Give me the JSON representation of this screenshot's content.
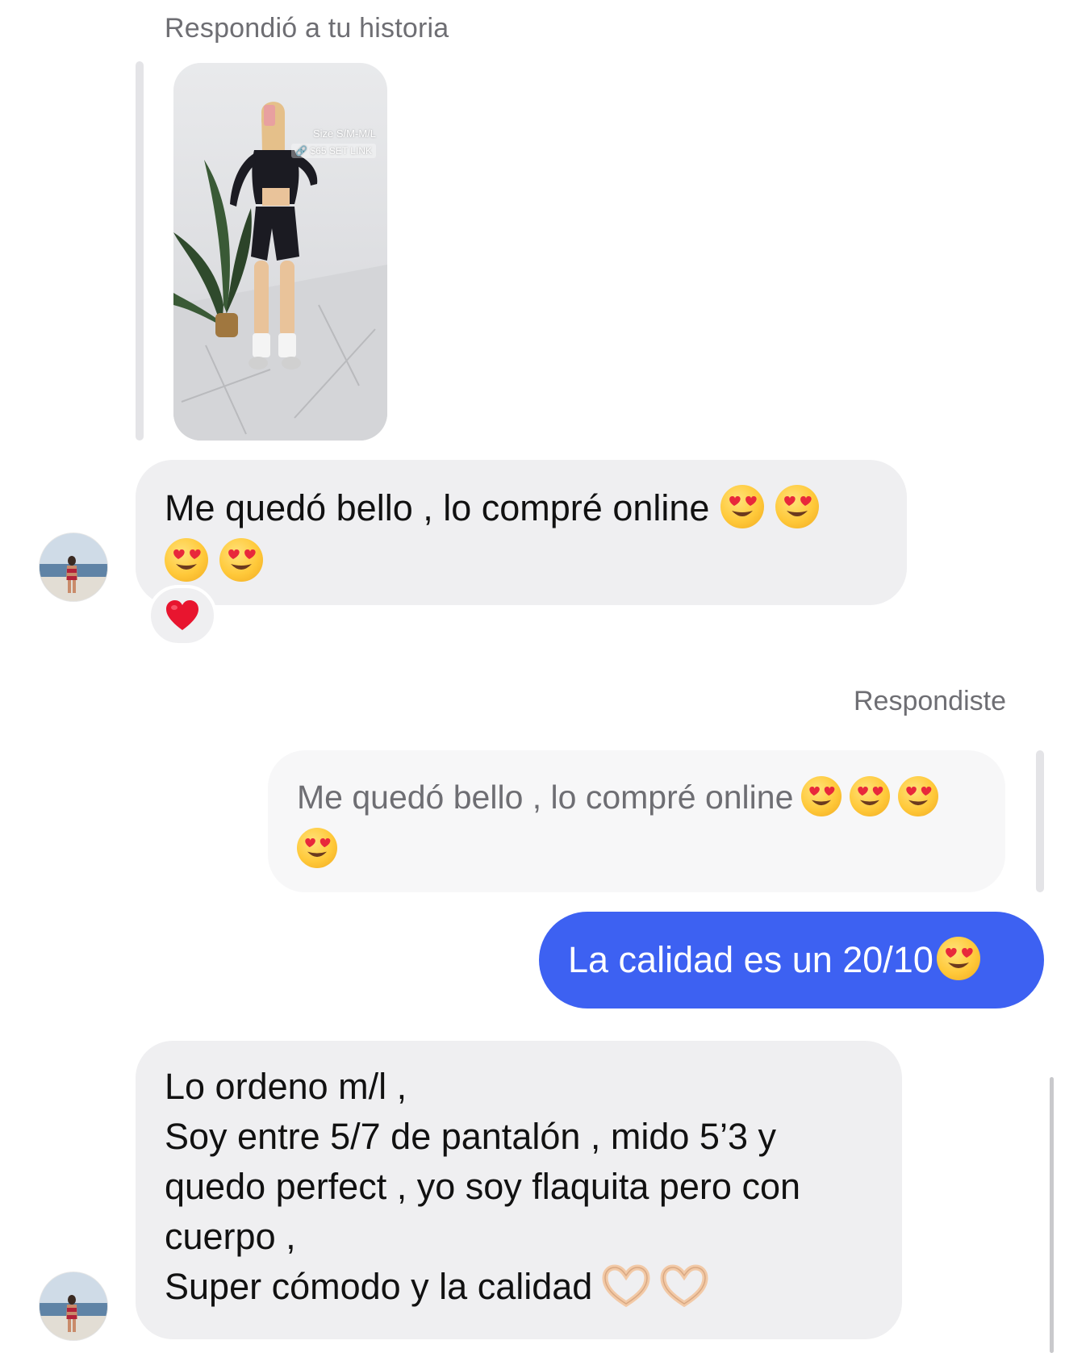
{
  "thread": {
    "story_reply_label": "Respondió a tu historia",
    "story": {
      "overlay_size": "Size S/M-M/L",
      "overlay_link": "$65 SET LINK"
    },
    "incoming_1": {
      "line1": "Me quedó bello , lo compré online",
      "reaction": "heart"
    },
    "replied_label": "Respondiste",
    "quoted_text": "Me quedó bello , lo compré online",
    "outgoing_1": {
      "text": "La calidad es un 20/10"
    },
    "incoming_2": {
      "line1": "Lo ordeno m/l ,",
      "line2": "Soy entre 5/7 de pantalón , mido 5’3 y",
      "line3": "quedo perfect , yo soy flaquita pero con",
      "line4": "cuerpo ,",
      "line5": "Super cómodo y la calidad"
    }
  },
  "colors": {
    "incoming_bubble": "#efeff1",
    "outgoing_bubble": "#3d61f2",
    "secondary_text": "#6e6e73"
  },
  "icons": {
    "emoji_face": "smiling-face-with-heart-eyes-icon",
    "emoji_hands": "heart-hands-icon",
    "reaction": "red-heart-icon"
  }
}
